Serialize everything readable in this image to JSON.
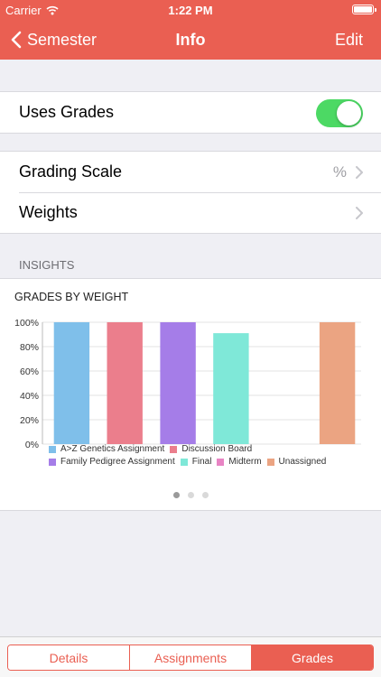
{
  "status_bar": {
    "carrier": "Carrier",
    "time": "1:22 PM"
  },
  "nav": {
    "back_label": "Semester",
    "title": "Info",
    "edit_label": "Edit"
  },
  "settings": {
    "uses_grades": {
      "label": "Uses Grades",
      "enabled": true
    },
    "grading_scale": {
      "label": "Grading Scale",
      "value": "%"
    },
    "weights": {
      "label": "Weights"
    }
  },
  "insights": {
    "section_header": "INSIGHTS",
    "pager": {
      "pages": 3,
      "active": 0
    }
  },
  "colors": {
    "accent": "#ea5f52",
    "toggle_on": "#4cd964"
  },
  "chart_data": {
    "type": "bar",
    "title": "GRADES BY WEIGHT",
    "categories": [
      "A>Z Genetics Assignment",
      "Discussion Board",
      "Family Pedigree Assignment",
      "Final",
      "Midterm",
      "Unassigned"
    ],
    "values": [
      100,
      100,
      100,
      91,
      0,
      100
    ],
    "colors": [
      "#7fbfea",
      "#eb7e8c",
      "#a57de8",
      "#7fe8d8",
      "#e884c4",
      "#eba482"
    ],
    "yticks": [
      "0%",
      "20%",
      "40%",
      "60%",
      "80%",
      "100%"
    ],
    "ylim": [
      0,
      100
    ],
    "grid": true
  },
  "tabs": [
    {
      "label": "Details",
      "active": false
    },
    {
      "label": "Assignments",
      "active": false
    },
    {
      "label": "Grades",
      "active": true
    }
  ]
}
